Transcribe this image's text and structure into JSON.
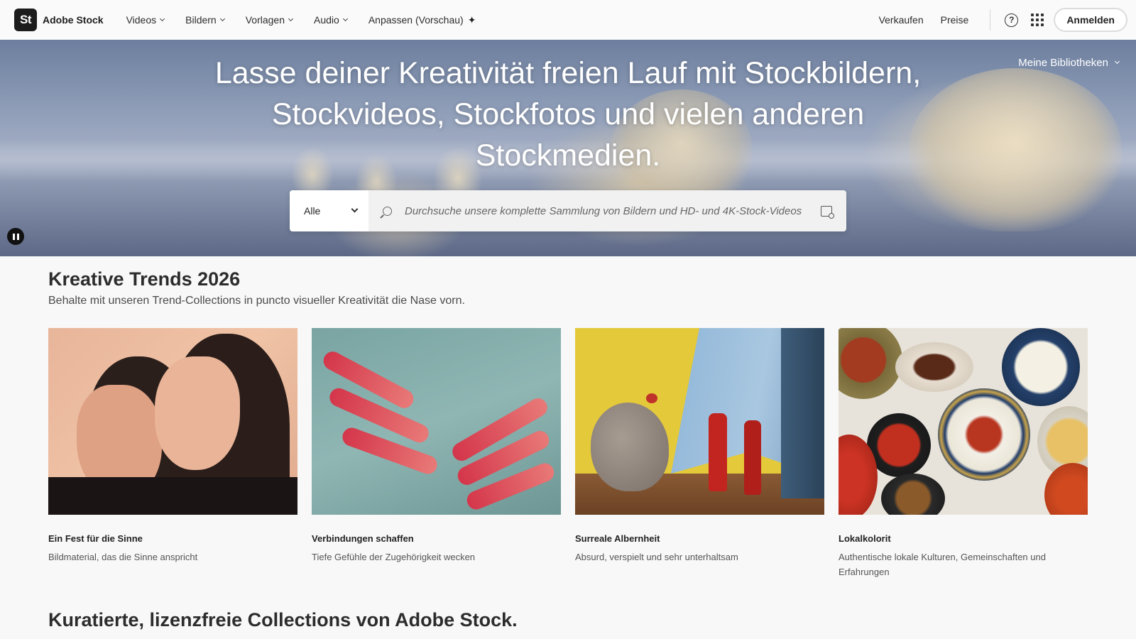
{
  "header": {
    "logo_text": "St",
    "brand": "Adobe Stock",
    "nav": [
      {
        "label": "Videos"
      },
      {
        "label": "Bildern"
      },
      {
        "label": "Vorlagen"
      },
      {
        "label": "Audio"
      },
      {
        "label": "Anpassen (Vorschau)"
      }
    ],
    "links": {
      "sell": "Verkaufen",
      "pricing": "Preise"
    },
    "help_glyph": "?",
    "signin": "Anmelden"
  },
  "hero": {
    "title": "Lasse deiner Kreativität freien Lauf mit Stockbildern, Stockvideos, Stockfotos und vielen anderen Stockmedien.",
    "libraries": "Meine Bibliotheken",
    "search": {
      "category": "Alle",
      "placeholder": "Durchsuche unsere komplette Sammlung von Bildern und HD- und 4K-Stock-Videos"
    }
  },
  "trends": {
    "title": "Kreative Trends 2026",
    "subtitle": "Behalte mit unseren Trend-Collections in puncto visueller Kreativität die Nase vorn.",
    "cards": [
      {
        "title": "Ein Fest für die Sinne",
        "desc": "Bildmaterial, das die Sinne anspricht"
      },
      {
        "title": "Verbindungen schaffen",
        "desc": "Tiefe Gefühle der Zugehörigkeit wecken"
      },
      {
        "title": "Surreale Albernheit",
        "desc": "Absurd, verspielt und sehr unterhaltsam"
      },
      {
        "title": "Lokalkolorit",
        "desc": "Authentische lokale Kulturen, Gemeinschaften und Erfahrungen"
      }
    ]
  },
  "curated": {
    "title": "Kuratierte, lizenzfreie Collections von Adobe Stock."
  },
  "colors": {
    "accent_dark": "#1c1c1c",
    "hero_sky": "#8c9bb6",
    "page_bg": "#f8f8f8"
  },
  "icons": [
    "chevron-down-icon",
    "sparkle-icon",
    "help-icon",
    "apps-grid-icon",
    "search-icon",
    "visual-search-icon",
    "pause-icon"
  ]
}
